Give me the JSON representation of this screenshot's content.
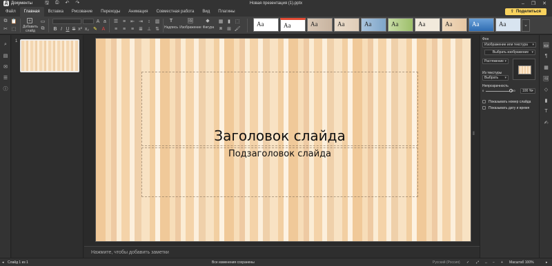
{
  "app": {
    "logo_label": "Документы",
    "document_title": "Новая презентация (1).pptx"
  },
  "window_controls": [
    "–",
    "❐",
    "✕"
  ],
  "menu": {
    "tabs": [
      "Файл",
      "Главная",
      "Вставка",
      "Рисование",
      "Переходы",
      "Анимация",
      "Совместная работа",
      "Вид",
      "Плагины"
    ],
    "active_tab": "Главная",
    "share_label": "Поделиться"
  },
  "toolbar": {
    "add_slide_label": "Добавить слайд",
    "caption_label": "Надпись",
    "image_label": "Изображение",
    "shape_label": "Фигура",
    "theme_preview_text": "Aa",
    "themes": [
      {
        "name": "theme-1",
        "bg": "#ffffff",
        "accent": "#2b5797"
      },
      {
        "name": "theme-2",
        "bg": "#ffffff",
        "accent": "#e34a33"
      },
      {
        "name": "theme-3",
        "bg": "#d9c7b5",
        "accent": "#8c6d4f"
      },
      {
        "name": "theme-4",
        "bg": "#eadccb",
        "accent": "#b89a7b"
      },
      {
        "name": "theme-5",
        "bg": "#7fa6c9",
        "accent": "#2d5c88"
      },
      {
        "name": "theme-6",
        "bg": "#9dbf6a",
        "accent": "#4c7a23"
      },
      {
        "name": "theme-7",
        "bg": "#f2eadc",
        "accent": "#c9b38f"
      },
      {
        "name": "theme-8",
        "bg": "#e6c7a3",
        "accent": "#b57b43"
      },
      {
        "name": "theme-9",
        "bg": "#2f6db3",
        "accent": "#9dc3ea"
      },
      {
        "name": "theme-10",
        "bg": "#d8e4f0",
        "accent": "#4178be"
      }
    ]
  },
  "thumbnails": {
    "slide_number": "1"
  },
  "slide": {
    "title": "Заголовок слайда",
    "subtitle": "Подзаголовок слайда"
  },
  "notes": {
    "placeholder": "Нажмите, чтобы добавить заметки"
  },
  "settings_panel": {
    "section_background": "Фон",
    "fill_type": "Изображение или текстура",
    "select_image": "Выбрать изображение",
    "stretch_mode": "Растяжение",
    "from_texture_label": "Из текстуры",
    "texture_select": "Выбрать",
    "opacity_label": "Непрозрачность",
    "opacity_min": "0",
    "opacity_max": "100",
    "opacity_value": "100 %",
    "opacity_percent": 100,
    "show_slide_number": "Показывать номер слайда",
    "show_date_time": "Показывать дату и время"
  },
  "statusbar": {
    "slide_counter": "Слайд 1 из 1",
    "save_status": "Все изменения сохранены",
    "language": "Русский (Россия)",
    "zoom": "Масштаб 100%"
  },
  "colors": {
    "accent": "#f8d25d",
    "slide_bg_base": "#f5d9b5"
  }
}
